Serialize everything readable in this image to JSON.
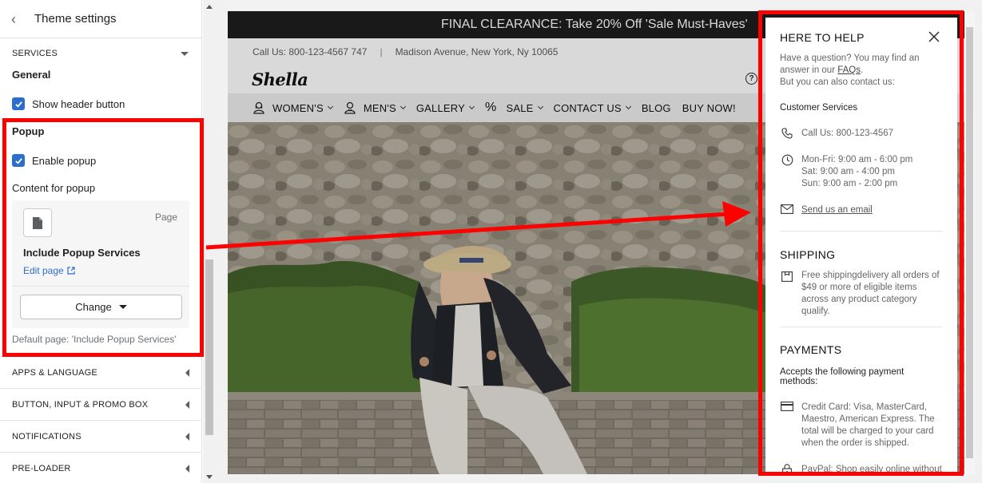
{
  "sidebar": {
    "title": "Theme settings",
    "services_label": "SERVICES",
    "general_title": "General",
    "show_header_button": "Show header button",
    "popup_title": "Popup",
    "enable_popup": "Enable popup",
    "content_label": "Content for popup",
    "page_tag": "Page",
    "page_name": "Include Popup Services",
    "edit_page": "Edit page",
    "change_button": "Change",
    "default_page": "Default page: 'Include Popup Services'",
    "sections": [
      "APPS & LANGUAGE",
      "BUTTON, INPUT & PROMO BOX",
      "NOTIFICATIONS",
      "PRE-LOADER"
    ]
  },
  "store": {
    "promo": "FINAL CLEARANCE: Take 20% Off 'Sale Must-Haves'",
    "phone": "Call Us: 800-123-4567 747",
    "address": "Madison Avenue, New York, Ny 10065",
    "separator": "|",
    "logo": "Shella",
    "help_glyph": "?",
    "nav": [
      {
        "label": "WOMEN'S",
        "icon": "woman-icon",
        "dropdown": true
      },
      {
        "label": "MEN'S",
        "icon": "man-icon",
        "dropdown": true
      },
      {
        "label": "GALLERY",
        "icon": "",
        "dropdown": true
      },
      {
        "label": "SALE",
        "icon": "percent-icon",
        "dropdown": true
      },
      {
        "label": "CONTACT US",
        "icon": "",
        "dropdown": true
      },
      {
        "label": "BLOG",
        "icon": "",
        "dropdown": false
      },
      {
        "label": "BUY NOW!",
        "icon": "",
        "dropdown": false
      }
    ]
  },
  "popup": {
    "title": "HERE TO HELP",
    "intro_1": "Have a question? You may find an answer in our ",
    "faqs_link": "FAQs",
    "intro_2": ".",
    "intro_3": "But you can also contact us:",
    "customer_services": "Customer Services",
    "call": "Call Us: 800-123-4567",
    "hours_1": "Mon-Fri: 9:00 am - 6:00 pm",
    "hours_2": "Sat: 9:00 am - 4:00 pm",
    "hours_3": "Sun: 9:00 am - 2:00 pm",
    "email_link": "Send us an email",
    "shipping_title": "SHIPPING",
    "shipping_text": "Free shippingdelivery all orders of $49 or more of eligible items across any product category qualify.",
    "payments_title": "PAYMENTS",
    "payments_intro": "Accepts the following payment methods:",
    "credit_card": "Credit Card: Visa, MasterCard, Maestro, American Express. The total will be charged to your card when the order is shipped.",
    "paypal": "PayPal: Shop easily online without having to enter your credit card"
  },
  "colors": {
    "accent_blue": "#2c6ecb",
    "annotation_red": "#ff0000",
    "promo_bg": "#1c1c1c"
  }
}
